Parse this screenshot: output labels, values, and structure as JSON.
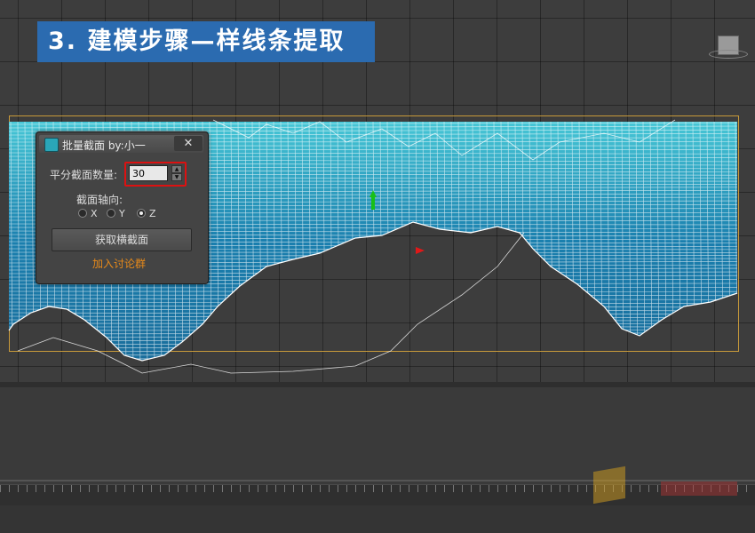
{
  "banner": {
    "title": "3. 建模步骤—样线条提取"
  },
  "dialog": {
    "title": "批量截面 by:小一",
    "close_label": "✕",
    "count_label": "平分截面数量:",
    "count_value": "30",
    "axis_label": "截面轴向:",
    "axes": [
      {
        "label": "X",
        "checked": false
      },
      {
        "label": "Y",
        "checked": false
      },
      {
        "label": "Z",
        "checked": true
      }
    ],
    "get_button": "获取横截面",
    "join_link": "加入讨论群"
  },
  "colors": {
    "banner_bg": "#2b6bb0",
    "terrain_fill": "#1e8fb2",
    "wire": "#ffffff",
    "highlight_box": "#dd1111",
    "link": "#e88a1a",
    "gizmo_y": "#18c018",
    "gizmo_x": "#e01818"
  },
  "icons": {
    "app": "3dsmax-icon",
    "close": "close-icon",
    "spin_up": "spin-up-icon",
    "spin_down": "spin-down-icon"
  }
}
